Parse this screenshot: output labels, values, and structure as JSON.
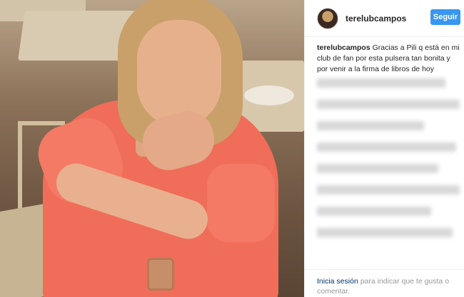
{
  "post": {
    "username": "terelubcampos",
    "follow_label": "Seguir",
    "caption_text": "Gracias a Pili q está en mi club de fan por esta pulsera tan bonita y por venir a la firma de libros de hoy",
    "footer": {
      "login_link": "Inicia sesión",
      "login_suffix": " para indicar que te gusta o comentar."
    }
  },
  "colors": {
    "follow_button": "#3897f0",
    "dress": "#f06d5a",
    "link": "#003569"
  },
  "icons": [
    "avatar"
  ]
}
